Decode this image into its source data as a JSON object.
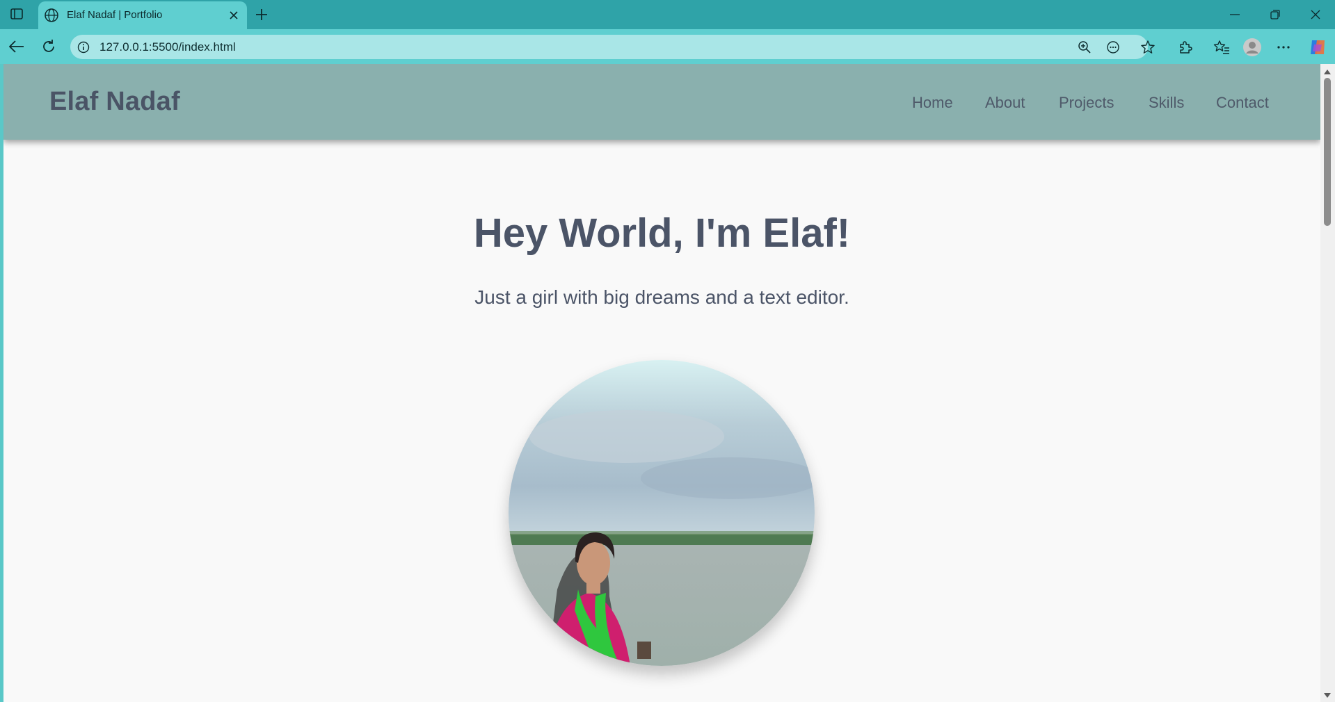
{
  "browser": {
    "tab_title": "Elaf Nadaf | Portfolio",
    "url": "127.0.0.1:5500/index.html"
  },
  "site": {
    "logo": "Elaf Nadaf",
    "nav": [
      "Home",
      "About",
      "Projects",
      "Skills",
      "Contact"
    ],
    "hero_title": "Hey World, I'm Elaf!",
    "hero_subtitle": "Just a girl with big dreams and a text editor."
  },
  "colors": {
    "tabbar": "#2fa3a8",
    "toolbar": "#5fcfd0",
    "header": "#8ab0ae",
    "text": "#4b5467",
    "page_bg": "#f9f9f9"
  }
}
